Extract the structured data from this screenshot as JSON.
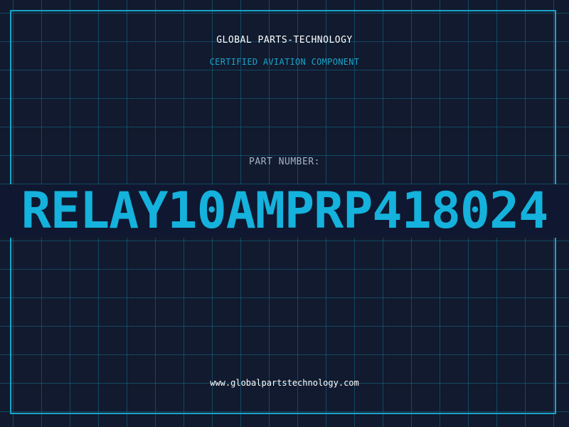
{
  "header": {
    "company": "GLOBAL PARTS-TECHNOLOGY",
    "subtitle": "CERTIFIED AVIATION COMPONENT"
  },
  "part": {
    "label": "PART NUMBER:",
    "number": "RELAY10AMPRP418024"
  },
  "footer": {
    "url": "www.globalpartstechnology.com"
  },
  "colors": {
    "background": "#111a2e",
    "accent": "#1aa3c9",
    "grid": "#166e8c",
    "text": "#ffffff",
    "muted": "#a5b4c8"
  }
}
